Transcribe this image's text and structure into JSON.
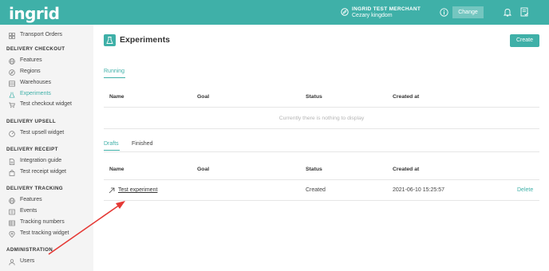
{
  "header": {
    "logo": "ingrid",
    "merchant_name": "INGRID TEST MERCHANT",
    "merchant_region": "Cezary kingdom",
    "change_label": "Change",
    "accent": "#3fb0a8"
  },
  "sidebar": {
    "top_item": "Transport Orders",
    "sections": {
      "checkout": "DELIVERY CHECKOUT",
      "upsell": "DELIVERY UPSELL",
      "receipt": "DELIVERY RECEIPT",
      "tracking": "DELIVERY TRACKING",
      "admin": "ADMINISTRATION"
    },
    "checkout_items": [
      "Features",
      "Regions",
      "Warehouses",
      "Experiments",
      "Test checkout widget"
    ],
    "upsell_items": [
      "Test upsell widget"
    ],
    "receipt_items": [
      "Integration guide",
      "Test receipt widget"
    ],
    "tracking_items": [
      "Features",
      "Events",
      "Tracking numbers",
      "Test tracking widget"
    ],
    "admin_items": [
      "Users"
    ],
    "active": "Experiments"
  },
  "main": {
    "title": "Experiments",
    "create_label": "Create",
    "running_tab": "Running",
    "columns": [
      "Name",
      "Goal",
      "Status",
      "Created at"
    ],
    "empty_text": "Currently there is nothing to display",
    "drafts_tab": "Drafts",
    "finished_tab": "Finished",
    "draft_rows": [
      {
        "name": "Test experiment",
        "goal": "",
        "status": "Created",
        "created_at": "2021-06-10 15:25:57",
        "action": "Delete"
      }
    ]
  }
}
